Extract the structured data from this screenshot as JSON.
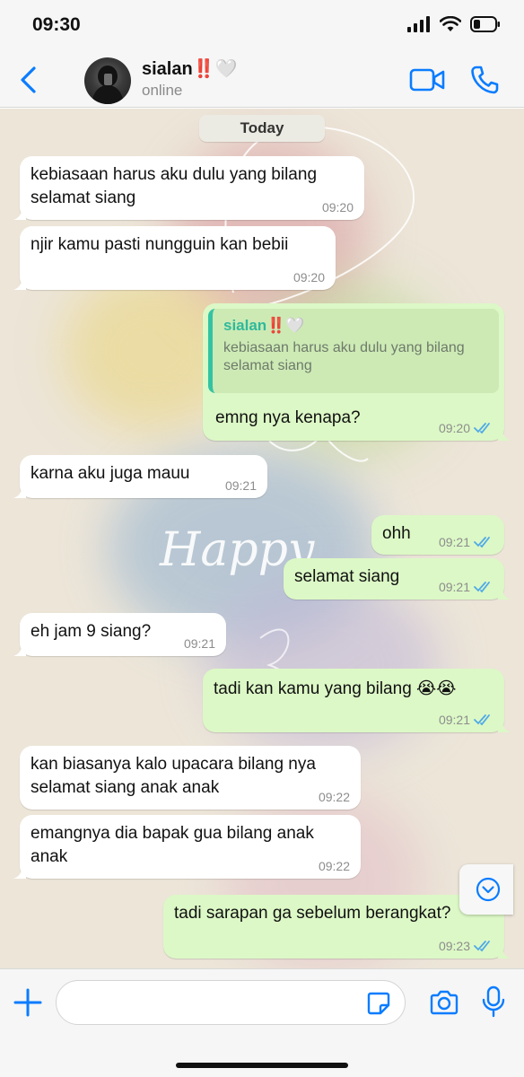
{
  "status_bar": {
    "time": "09:30"
  },
  "header": {
    "contact_name": "sialan‼️🤍",
    "contact_status": "online"
  },
  "chat": {
    "date_label": "Today",
    "messages": [
      {
        "dir": "in",
        "text": "kebiasaan harus aku dulu yang bilang selamat siang",
        "time": "09:20"
      },
      {
        "dir": "in",
        "text": "njir kamu pasti nungguin kan bebii",
        "time": "09:20"
      },
      {
        "dir": "out",
        "quote_name": "sialan‼️🤍",
        "quote_text": "kebiasaan harus aku dulu yang bilang selamat siang",
        "text": "emng nya kenapa?",
        "time": "09:20"
      },
      {
        "dir": "in",
        "text": "karna aku juga mauu",
        "time": "09:21"
      },
      {
        "dir": "out",
        "text": "ohh",
        "time": "09:21"
      },
      {
        "dir": "out",
        "text": "selamat siang",
        "time": "09:21"
      },
      {
        "dir": "in",
        "text": "eh jam 9 siang?",
        "time": "09:21"
      },
      {
        "dir": "out",
        "text": "tadi kan kamu yang bilang 😭😭",
        "time": "09:21"
      },
      {
        "dir": "in",
        "text": "kan biasanya kalo upacara bilang nya selamat siang anak anak",
        "time": "09:22"
      },
      {
        "dir": "in",
        "text": "emangnya dia bapak gua bilang anak anak",
        "time": "09:22"
      },
      {
        "dir": "out",
        "text": "tadi sarapan ga sebelum berangkat?",
        "time": "09:23"
      }
    ],
    "wallpaper_text": "Happy"
  },
  "compose": {
    "placeholder": ""
  },
  "colors": {
    "accent": "#0a7cff",
    "outgoing_bubble": "#dcf8c6",
    "incoming_bubble": "#ffffff",
    "read_ticks": "#4fa9e8",
    "quote_bar": "#34c3a2"
  }
}
